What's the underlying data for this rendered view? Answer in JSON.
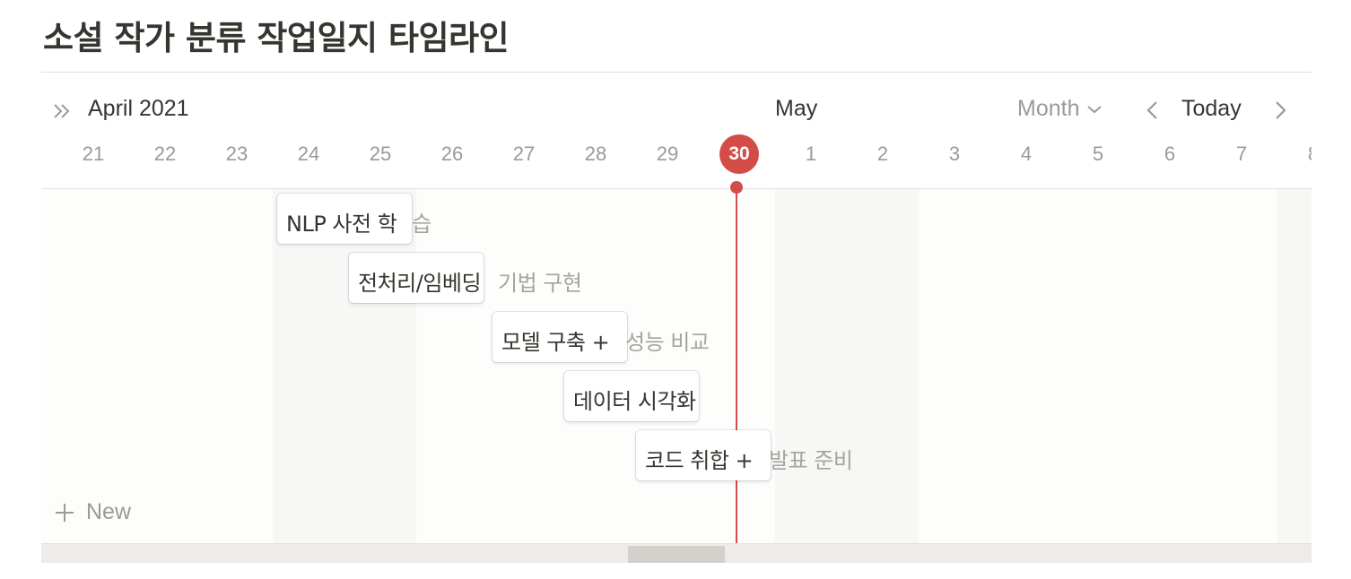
{
  "page": {
    "title": "소설 작가 분류 작업일지 타임라인"
  },
  "header": {
    "month_current": "April 2021",
    "month_next": "May",
    "view_mode": "Month",
    "today_label": "Today"
  },
  "days": [
    "21",
    "22",
    "23",
    "24",
    "25",
    "26",
    "27",
    "28",
    "29",
    "30",
    "1",
    "2",
    "3",
    "4",
    "5",
    "6",
    "7",
    "8"
  ],
  "today_day": "30",
  "tasks": [
    {
      "visible": "NLP 사전 학",
      "overflow": "습"
    },
    {
      "visible": "전처리/임베딩",
      "overflow": "기법 구현"
    },
    {
      "visible": "모델 구축 +",
      "overflow": "성능 비교"
    },
    {
      "visible": "데이터 시각화",
      "overflow": ""
    },
    {
      "visible": "코드 취합 +",
      "overflow": "발표 준비"
    }
  ],
  "new_button": {
    "label": "New"
  },
  "icons": {
    "expand": "double-chevron-right-icon",
    "chevron_down": "chevron-down-icon",
    "prev": "chevron-left-icon",
    "next": "chevron-right-icon",
    "add": "plus-icon"
  },
  "colors": {
    "today": "#d44c47",
    "text": "#37352f",
    "muted": "#9b9a97",
    "weekend": "#f7f7f5"
  }
}
